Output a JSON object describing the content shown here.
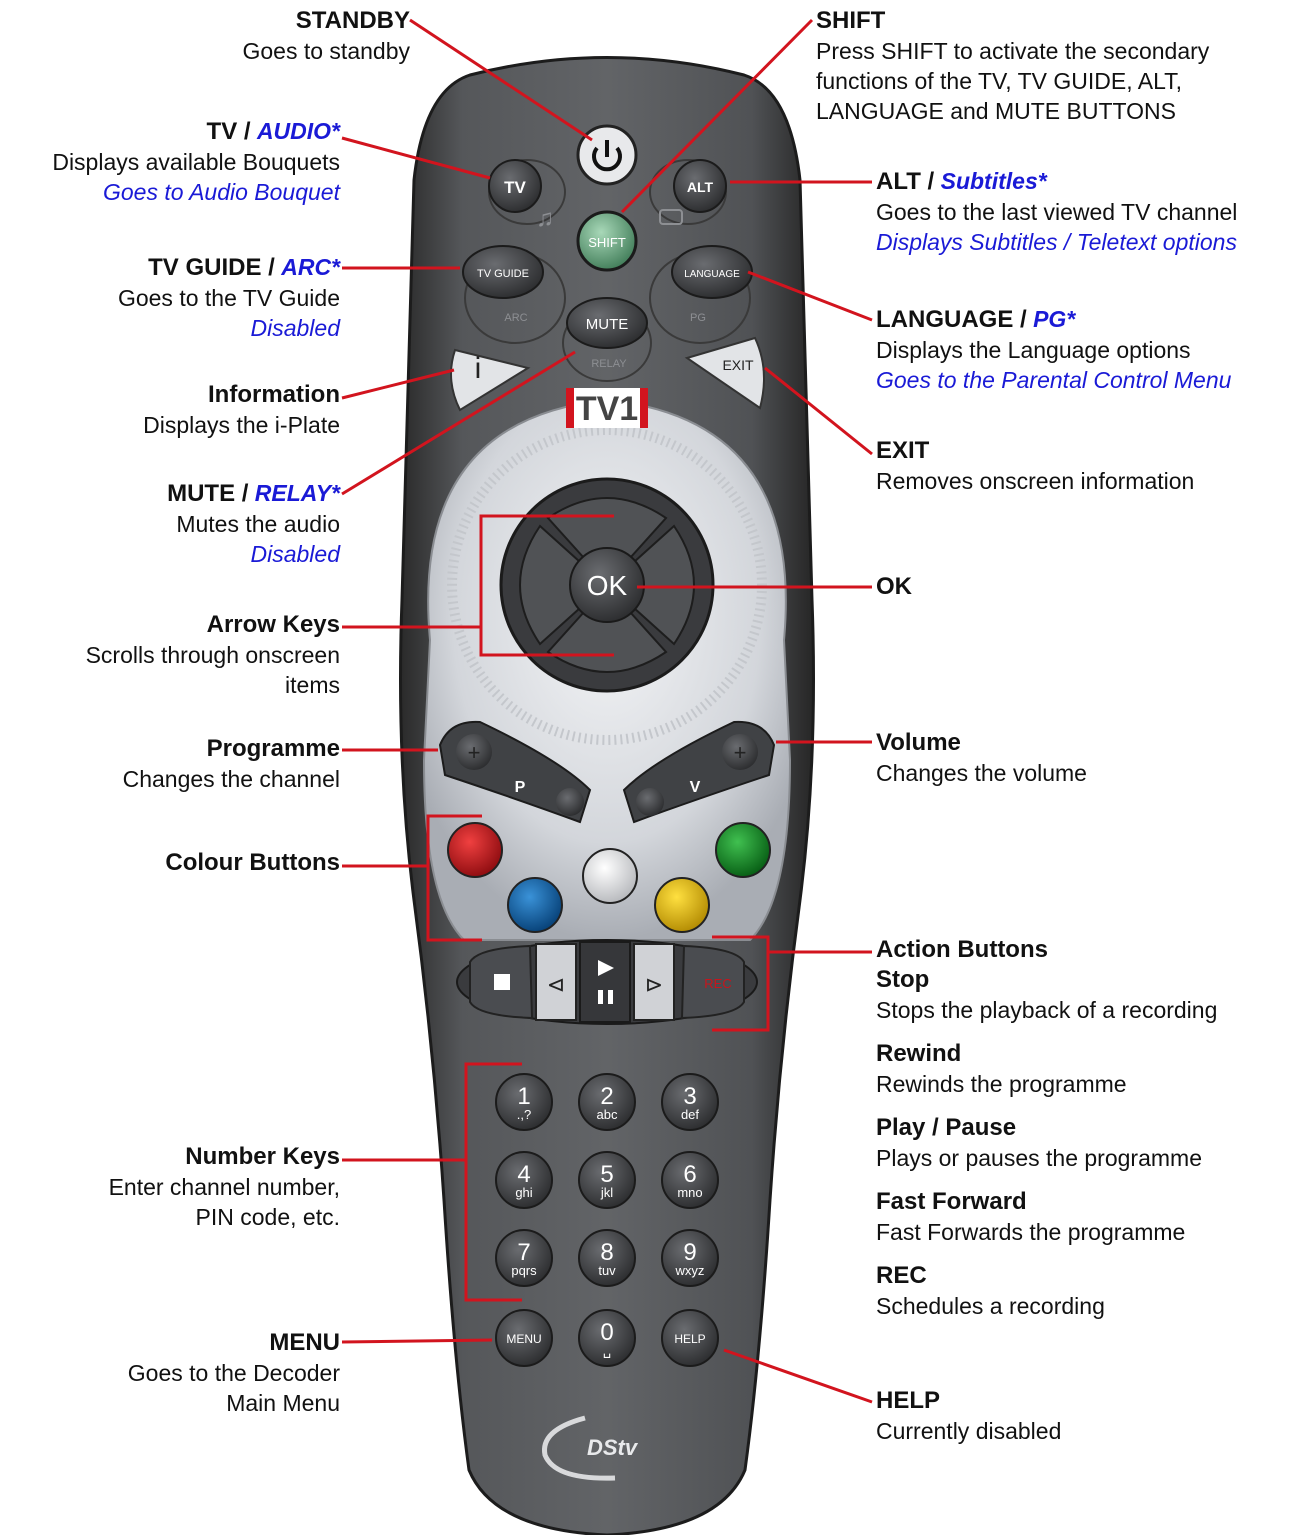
{
  "labels": {
    "standby": {
      "title": "STANDBY",
      "desc": "Goes to standby"
    },
    "shift": {
      "title": "SHIFT",
      "desc1": "Press SHIFT to activate the secondary",
      "desc2": "functions of the TV, TV GUIDE,  ALT,",
      "desc3": "LANGUAGE and MUTE BUTTONS"
    },
    "tv": {
      "title": "TV /",
      "alt": "AUDIO*",
      "desc": "Displays available Bouquets",
      "desc2": "Goes to Audio Bouquet"
    },
    "alt": {
      "title": "ALT /",
      "alt": "Subtitles*",
      "desc": "Goes to the last viewed TV channel",
      "desc2": "Displays Subtitles / Teletext options"
    },
    "tvguide": {
      "title": "TV GUIDE /",
      "alt": "ARC*",
      "desc": "Goes to the TV Guide",
      "desc2": "Disabled"
    },
    "language": {
      "title": "LANGUAGE /",
      "alt": "PG*",
      "desc": "Displays the Language options",
      "desc2": "Goes to the Parental Control Menu"
    },
    "information": {
      "title": "Information",
      "desc": "Displays the i-Plate"
    },
    "exit": {
      "title": "EXIT",
      "desc": "Removes onscreen information"
    },
    "mute": {
      "title": "MUTE /",
      "alt": "RELAY*",
      "desc": "Mutes the audio",
      "desc2": "Disabled"
    },
    "ok": {
      "title": "OK"
    },
    "arrows": {
      "title": "Arrow Keys",
      "desc1": "Scrolls through onscreen",
      "desc2": "items"
    },
    "programme": {
      "title": "Programme",
      "desc": "Changes the channel"
    },
    "volume": {
      "title": "Volume",
      "desc": "Changes the volume"
    },
    "colour": {
      "title": "Colour Buttons"
    },
    "action": {
      "title": "Action Buttons",
      "items": [
        {
          "title": "Stop",
          "desc": "Stops the playback of a recording"
        },
        {
          "title": "Rewind",
          "desc": "Rewinds the programme"
        },
        {
          "title": "Play / Pause",
          "desc": "Plays or pauses the programme"
        },
        {
          "title": "Fast Forward",
          "desc": "Fast Forwards the programme"
        },
        {
          "title": "REC",
          "desc": "Schedules a recording"
        }
      ]
    },
    "numbers": {
      "title": "Number Keys",
      "desc1": "Enter channel number,",
      "desc2": "PIN code, etc."
    },
    "menu": {
      "title": "MENU",
      "desc1": "Goes to the Decoder",
      "desc2": "Main Menu"
    },
    "help": {
      "title": "HELP",
      "desc": "Currently disabled"
    }
  },
  "remote": {
    "buttons": {
      "tv": "TV",
      "alt": "ALT",
      "shift": "SHIFT",
      "tvguide": "TV GUIDE",
      "language": "LANGUAGE",
      "arc": "ARC",
      "pg": "PG",
      "mute": "MUTE",
      "relay": "RELAY",
      "info": "i",
      "exit": "EXIT",
      "ok": "OK",
      "prog": "P",
      "vol": "V",
      "rec": "REC",
      "menu": "MENU",
      "help": "HELP"
    },
    "brand": "DStv",
    "channel_logo": "TV1",
    "keys": [
      {
        "n": "1",
        "s": ".,?"
      },
      {
        "n": "2",
        "s": "abc"
      },
      {
        "n": "3",
        "s": "def"
      },
      {
        "n": "4",
        "s": "ghi"
      },
      {
        "n": "5",
        "s": "jkl"
      },
      {
        "n": "6",
        "s": "mno"
      },
      {
        "n": "7",
        "s": "pqrs"
      },
      {
        "n": "8",
        "s": "tuv"
      },
      {
        "n": "9",
        "s": "wxyz"
      },
      {
        "n": "0",
        "s": "␣"
      }
    ],
    "colors": {
      "red": "#c8121a",
      "blue": "#0a64b0",
      "white": "#f4f4f4",
      "yellow": "#f2c200",
      "green": "#0d8a22",
      "shift": "#6aa882",
      "callout": "#d2141e"
    }
  }
}
